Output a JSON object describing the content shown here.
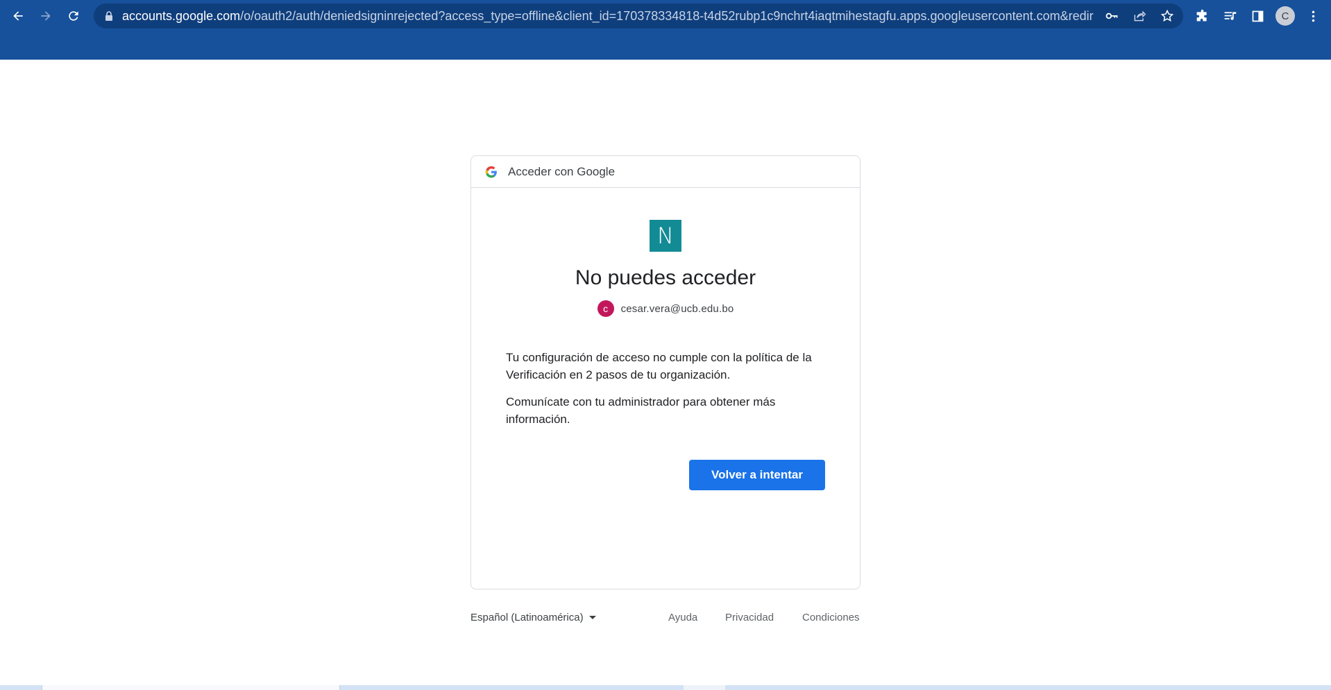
{
  "browser": {
    "url_host": "accounts.google.com",
    "url_path": "/o/oauth2/auth/deniedsigninrejected?access_type=offline&client_id=170378334818-t4d52rubp1c9nchrt4iaqtmihestagfu.apps.googleusercontent.com&redirec...",
    "profile_initial": "C",
    "icons": [
      "back-icon",
      "forward-icon",
      "reload-icon",
      "lock-icon",
      "key-icon",
      "share-icon",
      "star-icon",
      "extensions-icon",
      "media-icon",
      "side-panel-icon",
      "menu-icon"
    ],
    "accent_color": "#17519b"
  },
  "card": {
    "header_text": "Acceder con Google",
    "app_logo_letter": "N",
    "app_logo_color": "#138b95",
    "title": "No puedes acceder",
    "account": {
      "initial": "c",
      "email": "cesar.vera@ucb.edu.bo",
      "avatar_color": "#c2185b"
    },
    "message_1": "Tu configuración de acceso no cumple con la política de la Verificación en 2 pasos de tu organización.",
    "message_2": "Comunícate con tu administrador para obtener más información.",
    "retry_button": "Volver a intentar",
    "button_color": "#1a73e8"
  },
  "footer": {
    "language": "Español (Latinoamérica)",
    "help": "Ayuda",
    "privacy": "Privacidad",
    "terms": "Condiciones"
  }
}
